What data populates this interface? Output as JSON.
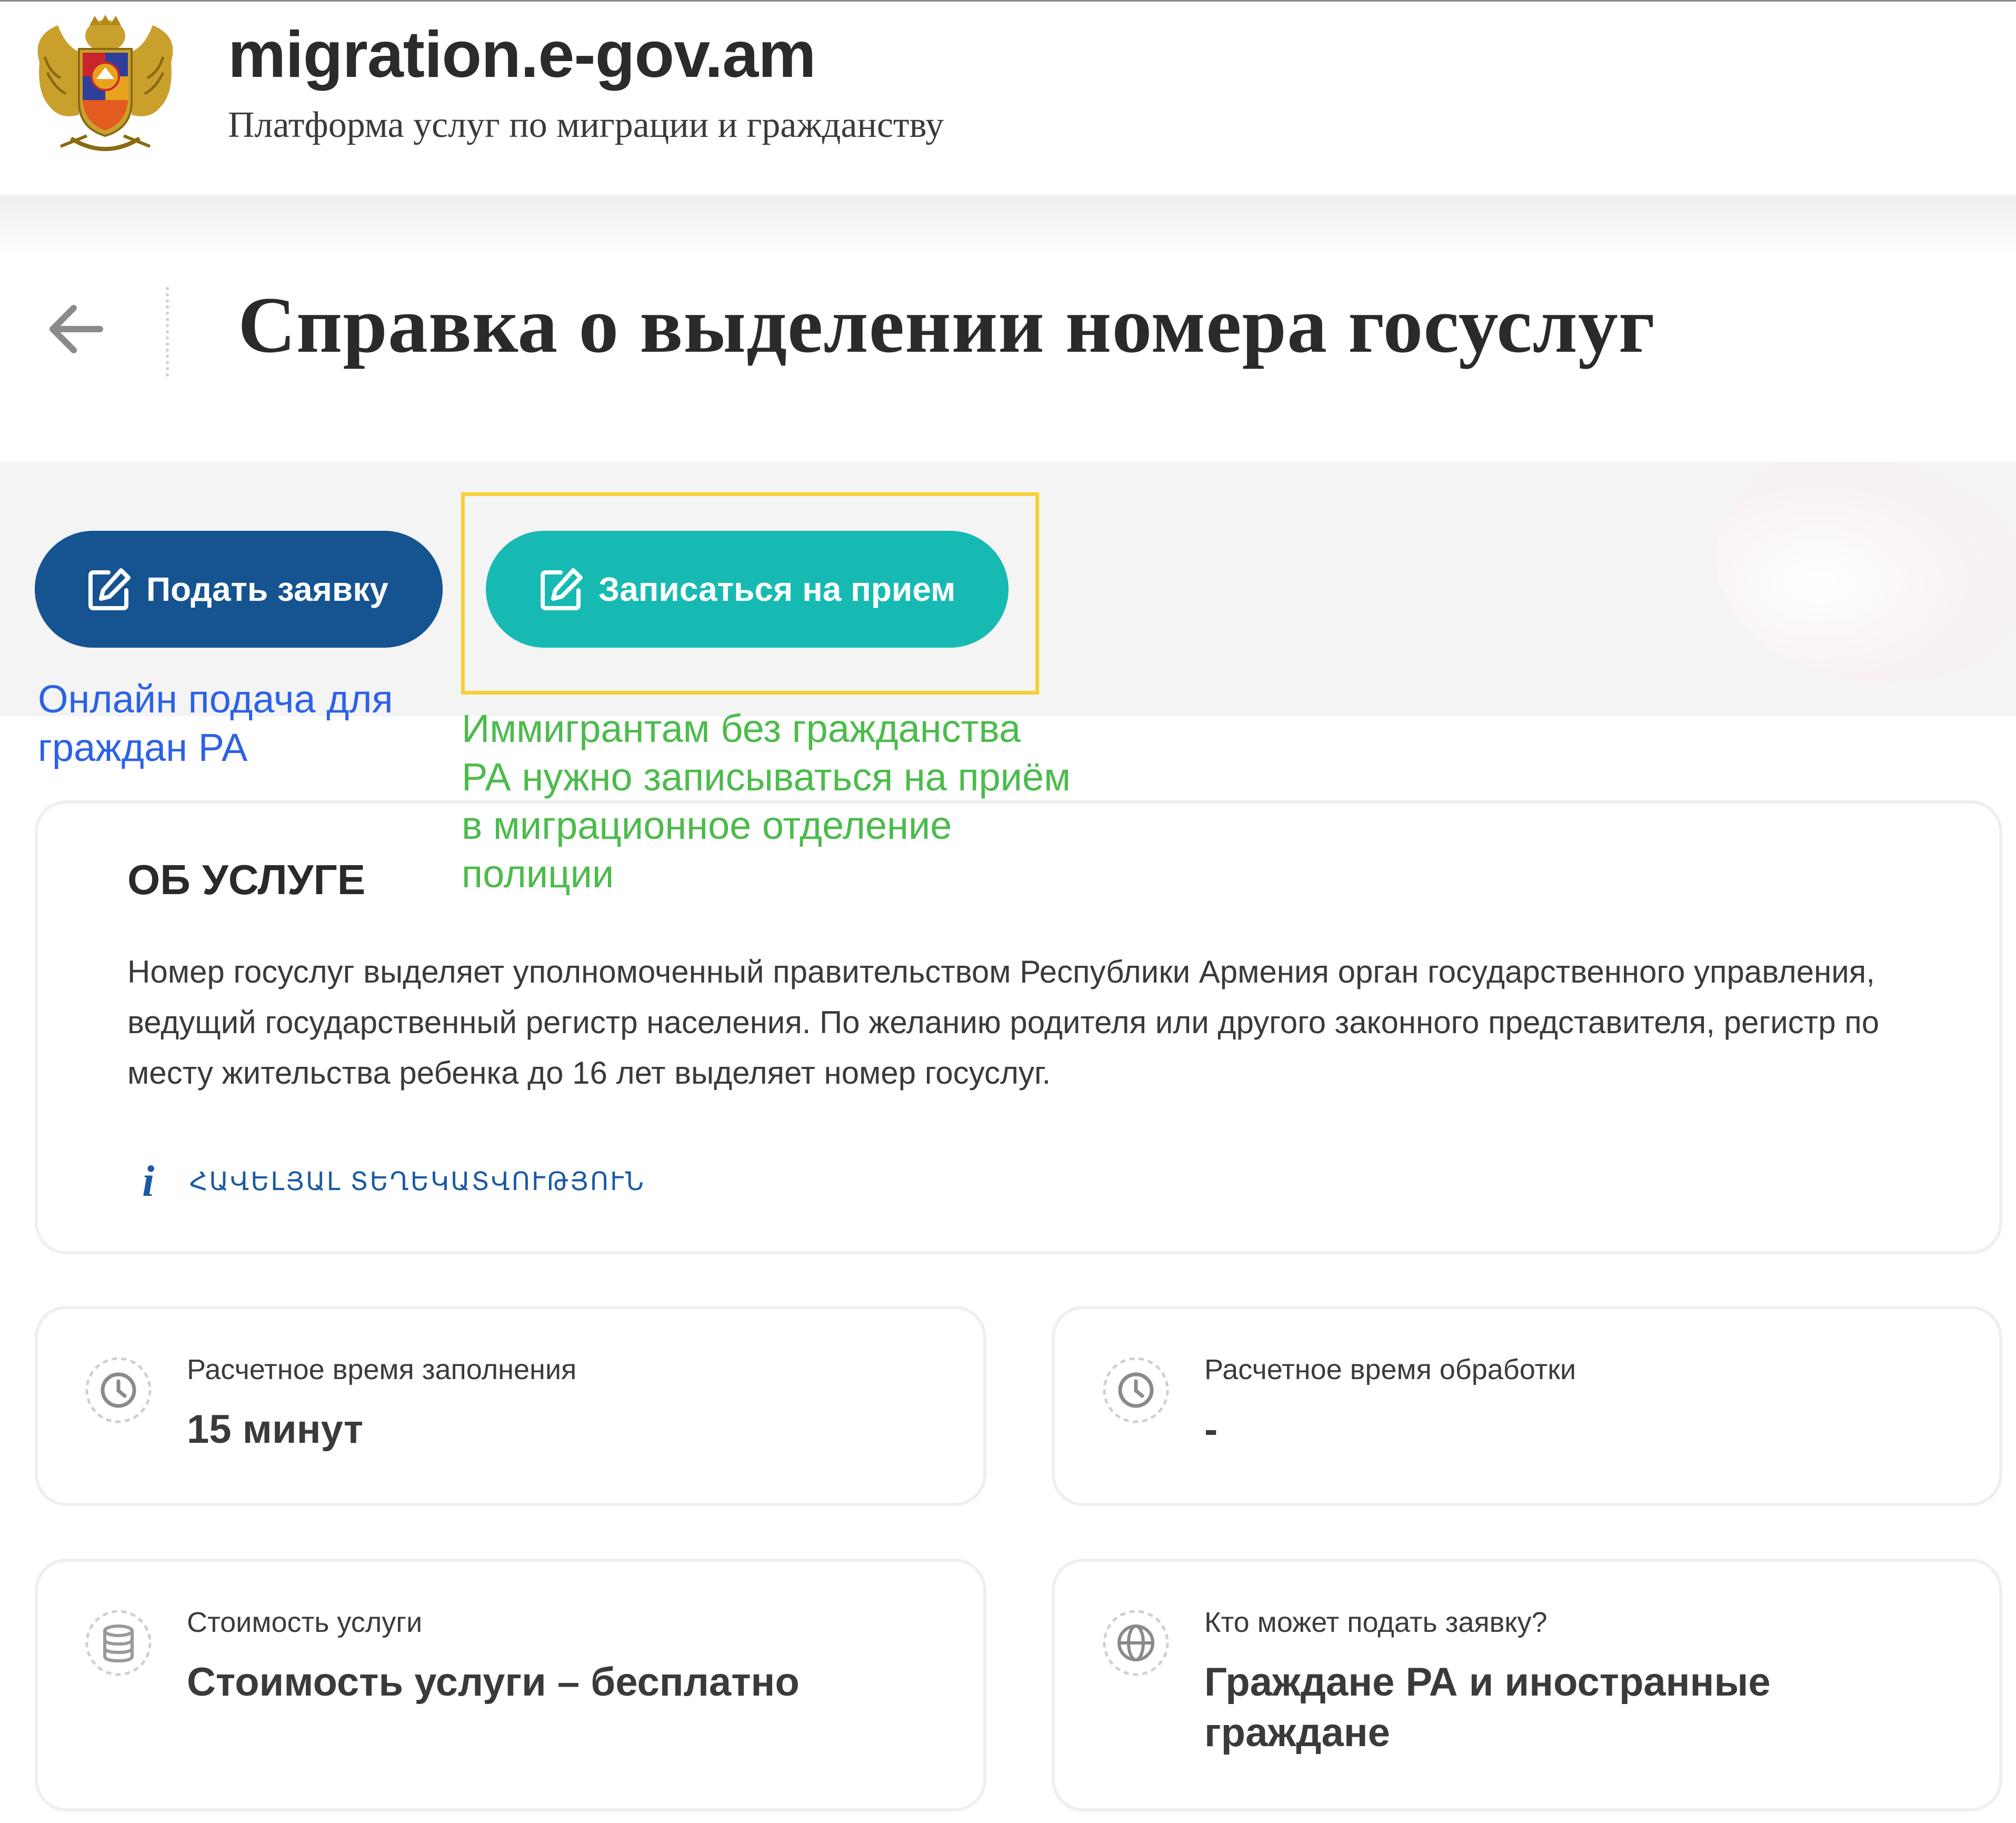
{
  "header": {
    "site_name": "migration.e-gov.am",
    "subtitle": "Платформа услуг по миграции и гражданству"
  },
  "page": {
    "title": "Справка о выделении номера госуслуг"
  },
  "actions": {
    "apply_label": "Подать заявку",
    "book_label": "Записаться на прием"
  },
  "annotations": {
    "apply_note": "Онлайн подача для граждан РА",
    "book_note": "Иммигрантам без гражданства РА нужно записываться на приём в миграционное отделение полиции"
  },
  "about": {
    "heading": "ОБ УСЛУГЕ",
    "text": "Номер госуслуг выделяет уполномоченный правительством Республики Армения орган государственного управления, ведущий государственный регистр населения. По желанию родителя или другого законного представителя, регистр по месту жительства ребенка до 16 лет выделяет номер госуслуг.",
    "info_link": "ՀԱՎԵԼՅԱԼ ՏԵՂԵԿԱՏՎՈՒԹՅՈՒՆ"
  },
  "details": [
    {
      "icon": "clock-icon",
      "label": "Расчетное время заполнения",
      "value": "15 минут"
    },
    {
      "icon": "clock-icon",
      "label": "Расчетное время обработки",
      "value": "-"
    },
    {
      "icon": "coins-icon",
      "label": "Стоимость услуги",
      "value": "Стоимость услуги – бесплатно"
    },
    {
      "icon": "globe-icon",
      "label": "Кто может подать заявку?",
      "value": "Граждане РА и иностранные граждане"
    }
  ],
  "colors": {
    "apply_button": "#155391",
    "book_button": "#17bab3",
    "highlight_border": "#f5d033",
    "apply_note": "#2c62e6",
    "book_note": "#4cbb4c",
    "link": "#1b5aa2"
  }
}
